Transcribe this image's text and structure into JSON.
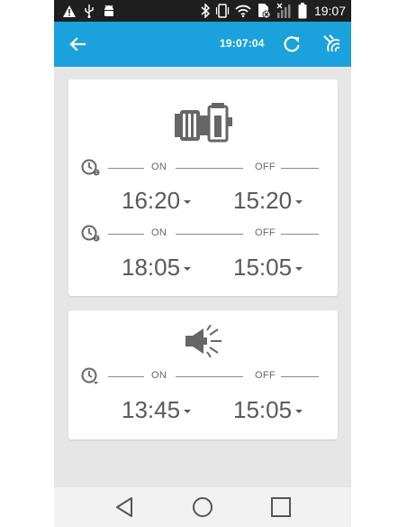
{
  "status_bar": {
    "time": "19:07",
    "left_icons": [
      "warning-icon",
      "usb-icon",
      "android-debug-icon"
    ],
    "right_icons": [
      "bluetooth-icon",
      "vibrate-icon",
      "wifi-icon",
      "no-sim-icon",
      "signal-icon",
      "battery-icon"
    ]
  },
  "app_bar": {
    "clock": "19:07:04",
    "back_icon": "arrow-back-icon",
    "refresh_icon": "refresh-icon",
    "sync_icon": "wireless-sync-icon",
    "color": "#1ba1dc"
  },
  "pump_card": {
    "icon": "pump-icon",
    "timers": [
      {
        "on_label": "ON",
        "off_label": "OFF",
        "on_time": "16:20",
        "off_time": "15:20"
      },
      {
        "on_label": "ON",
        "off_label": "OFF",
        "on_time": "18:05",
        "off_time": "15:05"
      }
    ]
  },
  "speaker_card": {
    "icon": "speaker-icon",
    "timers": [
      {
        "on_label": "ON",
        "off_label": "OFF",
        "on_time": "13:45",
        "off_time": "15:05"
      }
    ]
  },
  "nav_bar": {
    "buttons": [
      "back-triangle-icon",
      "home-circle-icon",
      "recents-square-icon"
    ]
  }
}
